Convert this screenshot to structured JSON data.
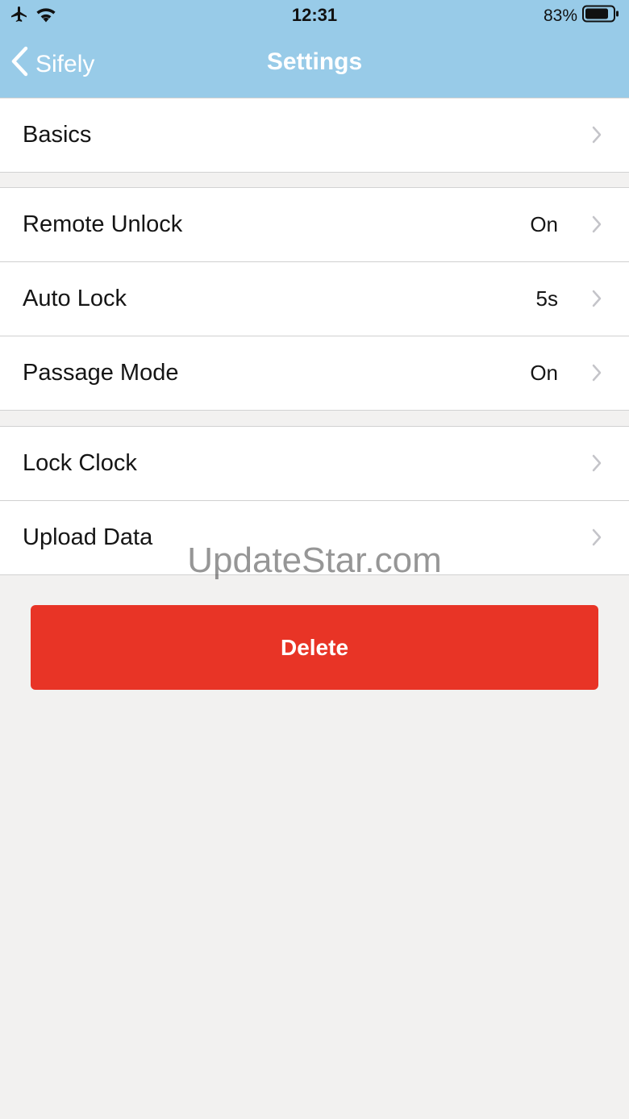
{
  "status_bar": {
    "time": "12:31",
    "battery_percent": "83%",
    "icons": [
      "airplane-icon",
      "wifi-icon",
      "battery-icon"
    ]
  },
  "nav": {
    "back_label": "Sifely",
    "title": "Settings"
  },
  "groups": [
    {
      "rows": [
        {
          "label": "Basics",
          "value": ""
        }
      ]
    },
    {
      "rows": [
        {
          "label": "Remote Unlock",
          "value": "On"
        },
        {
          "label": "Auto Lock",
          "value": "5s"
        },
        {
          "label": "Passage Mode",
          "value": "On"
        }
      ]
    },
    {
      "rows": [
        {
          "label": "Lock Clock",
          "value": ""
        },
        {
          "label": "Upload Data",
          "value": ""
        }
      ]
    }
  ],
  "watermark": "UpdateStar.com",
  "delete_label": "Delete",
  "colors": {
    "nav_background": "#98cbe8",
    "page_background": "#f2f1f0",
    "delete_button": "#e83426",
    "chevron": "#c4c4c9"
  }
}
